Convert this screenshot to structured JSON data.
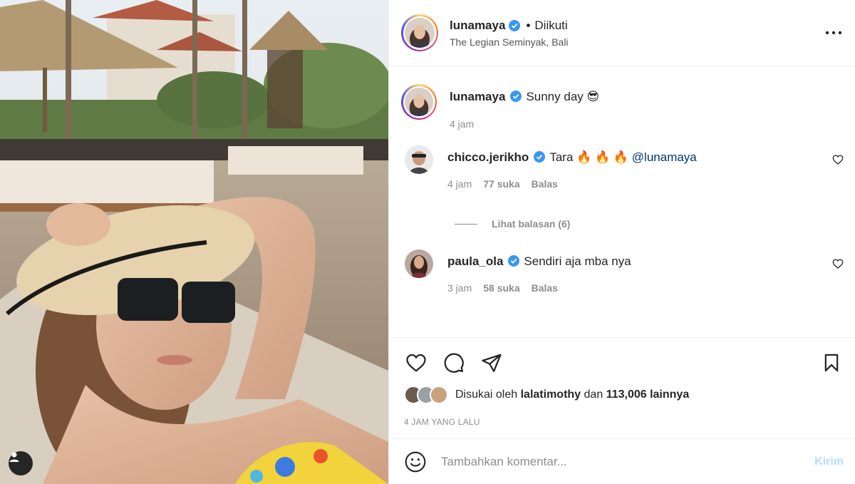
{
  "post": {
    "author": "lunamaya",
    "separator": "•",
    "follow_status": "Diikuti",
    "location": "The Legian Seminyak, Bali",
    "more_icon": "more-horizontal-icon",
    "caption": {
      "username": "lunamaya",
      "text": "Sunny day 😎",
      "time": "4 jam"
    },
    "comments": [
      {
        "username": "chicco.jerikho",
        "text": "Tara 🔥 🔥 🔥 ",
        "mention": "@lunamaya",
        "time": "4 jam",
        "likes": "77 suka",
        "reply": "Balas"
      },
      {
        "username": "paula_ola",
        "text": "Sendiri aja mba nya",
        "mention": "",
        "time": "3 jam",
        "likes": "58 suka",
        "reply": "Balas"
      }
    ],
    "view_replies": "Lihat balasan (6)",
    "liked_by_prefix": "Disukai oleh",
    "liked_by_user": "lalatimothy",
    "liked_by_mid": "dan",
    "liked_by_count": "113,006 lainnya",
    "time_ago": "4 JAM YANG LALU",
    "add_comment_placeholder": "Tambahkan komentar...",
    "post_button": "Kirim"
  },
  "colors": {
    "verified": "#3897f0",
    "link": "#00376b",
    "muted": "#8e8e8e",
    "post_button_disabled": "#b2dffc"
  }
}
